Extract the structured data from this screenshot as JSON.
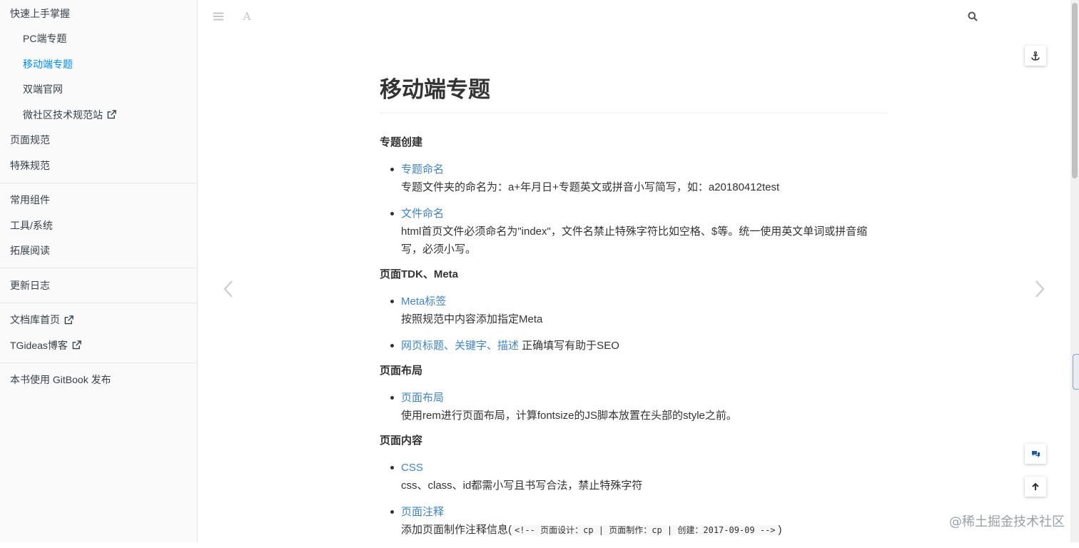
{
  "sidebar": {
    "items": [
      {
        "label": "快速上手掌握"
      },
      {
        "label": "PC端专题"
      },
      {
        "label": "移动端专题"
      },
      {
        "label": "双端官网"
      },
      {
        "label": "微社区技术规范站"
      },
      {
        "label": "页面规范"
      },
      {
        "label": "特殊规范"
      },
      {
        "label": "常用组件"
      },
      {
        "label": "工具/系统"
      },
      {
        "label": "拓展阅读"
      },
      {
        "label": "更新日志"
      },
      {
        "label": "文档库首页"
      },
      {
        "label": "TGideas博客"
      },
      {
        "label": "本书使用 GitBook 发布"
      }
    ],
    "active_color": "#008cff"
  },
  "header": {
    "menu_icon": "menu-icon",
    "font_icon": "font-settings-icon",
    "font_glyph": "A",
    "search_icon": "search-icon"
  },
  "content": {
    "title": "移动端专题",
    "sections": [
      {
        "heading": "专题创建",
        "items": [
          {
            "link": "专题命名",
            "desc": "专题文件夹的命名为：a+年月日+专题英文或拼音小写简写，如：a20180412test"
          },
          {
            "link": "文件命名",
            "desc": "html首页文件必须命名为\"index\"，文件名禁止特殊字符比如空格、$等。统一使用英文单词或拼音缩写，必须小写。"
          }
        ]
      },
      {
        "heading": "页面TDK、Meta",
        "items": [
          {
            "link": "Meta标签",
            "desc": "按照规范中内容添加指定Meta"
          },
          {
            "link": "网页标题、关键字、描述",
            "inline": " 正确填写有助于SEO"
          }
        ]
      },
      {
        "heading": "页面布局",
        "items": [
          {
            "link": "页面布局",
            "desc": "使用rem进行页面布局，计算fontsize的JS脚本放置在头部的style之前。"
          }
        ]
      },
      {
        "heading": "页面内容",
        "items": [
          {
            "link": "CSS",
            "desc": "css、class、id都需小写且书写合法，禁止特殊字符"
          },
          {
            "link": "页面注释",
            "desc_prefix": "添加页面制作注释信息(",
            "code": "<!-- 页面设计：cp | 页面制作：cp | 创建：2017-09-09 -->",
            "desc_suffix": ")"
          }
        ]
      }
    ]
  },
  "watermark": "@稀土掘金技术社区",
  "link_color": "#4183c4"
}
